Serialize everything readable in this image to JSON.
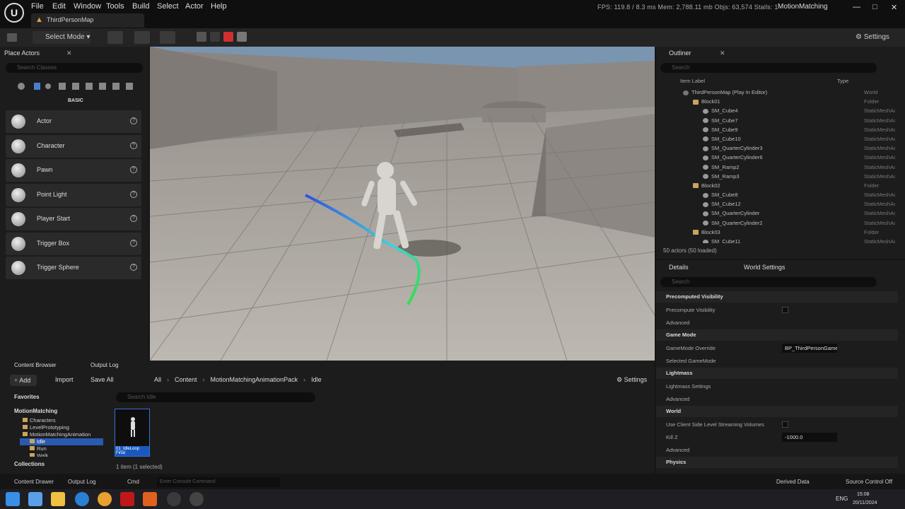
{
  "app": {
    "tab_title": "ThirdPersonMap",
    "project": "MotionMatching",
    "stats": "FPS: 119.8 / 8.3 ms  Mem: 2,788.11 mb  Objs: 63,574  Stalls: 1"
  },
  "menu": [
    "File",
    "Edit",
    "Window",
    "Tools",
    "Build",
    "Select",
    "Actor",
    "Help"
  ],
  "window_controls": {
    "minimize": "—",
    "maximize": "□",
    "close": "✕"
  },
  "toolbar": {
    "mode": "Select Mode",
    "settings": "Settings"
  },
  "place_actors": {
    "title": "Place Actors",
    "search_placeholder": "Search Classes",
    "category": "BASIC",
    "items": [
      "Actor",
      "Character",
      "Pawn",
      "Point Light",
      "Player Start",
      "Trigger Box",
      "Trigger Sphere"
    ]
  },
  "outliner": {
    "title": "Outliner",
    "search_placeholder": "Search",
    "col_label": "Item Label",
    "col_type": "Type",
    "rows": [
      {
        "label": "ThirdPersonMap (Play In Editor)",
        "type": "World",
        "indent": 0
      },
      {
        "label": "Block01",
        "type": "Folder",
        "indent": 1
      },
      {
        "label": "SM_Cube4",
        "type": "StaticMeshActor",
        "indent": 2
      },
      {
        "label": "SM_Cube7",
        "type": "StaticMeshActor",
        "indent": 2
      },
      {
        "label": "SM_Cube9",
        "type": "StaticMeshActor",
        "indent": 2
      },
      {
        "label": "SM_Cube10",
        "type": "StaticMeshActor",
        "indent": 2
      },
      {
        "label": "SM_QuarterCylinder3",
        "type": "StaticMeshActor",
        "indent": 2
      },
      {
        "label": "SM_QuarterCylinder6",
        "type": "StaticMeshActor",
        "indent": 2
      },
      {
        "label": "SM_Ramp2",
        "type": "StaticMeshActor",
        "indent": 2
      },
      {
        "label": "SM_Ramp3",
        "type": "StaticMeshActor",
        "indent": 2
      },
      {
        "label": "Block02",
        "type": "Folder",
        "indent": 1
      },
      {
        "label": "SM_Cube8",
        "type": "StaticMeshActor",
        "indent": 2
      },
      {
        "label": "SM_Cube12",
        "type": "StaticMeshActor",
        "indent": 2
      },
      {
        "label": "SM_QuarterCylinder",
        "type": "StaticMeshActor",
        "indent": 2
      },
      {
        "label": "SM_QuarterCylinder2",
        "type": "StaticMeshActor",
        "indent": 2
      },
      {
        "label": "Block03",
        "type": "Folder",
        "indent": 1
      },
      {
        "label": "SM_Cube11",
        "type": "StaticMeshActor",
        "indent": 2
      }
    ],
    "footer": "50 actors (50 loaded)"
  },
  "details": {
    "tab1": "Details",
    "tab2": "World Settings",
    "search_placeholder": "Search",
    "sections": [
      {
        "name": "Precomputed Visibility",
        "props": [
          {
            "label": "Precompute Visibility",
            "value": "checkbox"
          },
          {
            "label": "Advanced",
            "value": ""
          }
        ]
      },
      {
        "name": "Game Mode",
        "props": [
          {
            "label": "GameMode Override",
            "value": "BP_ThirdPersonGameMode"
          },
          {
            "label": "Selected GameMode",
            "value": ""
          }
        ]
      },
      {
        "name": "Lightmass",
        "props": [
          {
            "label": "Lightmass Settings",
            "value": ""
          },
          {
            "label": "Advanced",
            "value": ""
          }
        ]
      },
      {
        "name": "World",
        "props": [
          {
            "label": "Use Client Side Level Streaming Volumes",
            "value": "checkbox"
          },
          {
            "label": "Kill Z",
            "value": "-1000.0"
          },
          {
            "label": "Advanced",
            "value": ""
          }
        ]
      },
      {
        "name": "Physics",
        "props": []
      }
    ]
  },
  "content_browser": {
    "tab1": "Content Browser",
    "tab2": "Output Log",
    "add": "Add",
    "import": "Import",
    "save_all": "Save All",
    "breadcrumbs": [
      "All",
      "Content",
      "MotionMatchingAnimationPack",
      "Idle"
    ],
    "settings": "Settings",
    "favorites": "Favorites",
    "project": "MotionMatching",
    "search_placeholder": "Search Idle",
    "tree": [
      "Characters",
      "LevelPrototyping",
      "MotionMatchingAnimation",
      "Idle",
      "Run",
      "Walk"
    ],
    "asset_label": "01_IdleLoop Final",
    "collections": "Collections",
    "status": "1 item (1 selected)"
  },
  "statusbar": {
    "content_drawer": "Content Drawer",
    "output_log": "Output Log",
    "cmd": "Cmd",
    "console_placeholder": "Enter Console Command",
    "derived_data": "Derived Data",
    "source_control": "Source Control Off"
  },
  "taskbar": {
    "lang": "ENG",
    "time": "15:08",
    "date": "20/11/2024"
  }
}
